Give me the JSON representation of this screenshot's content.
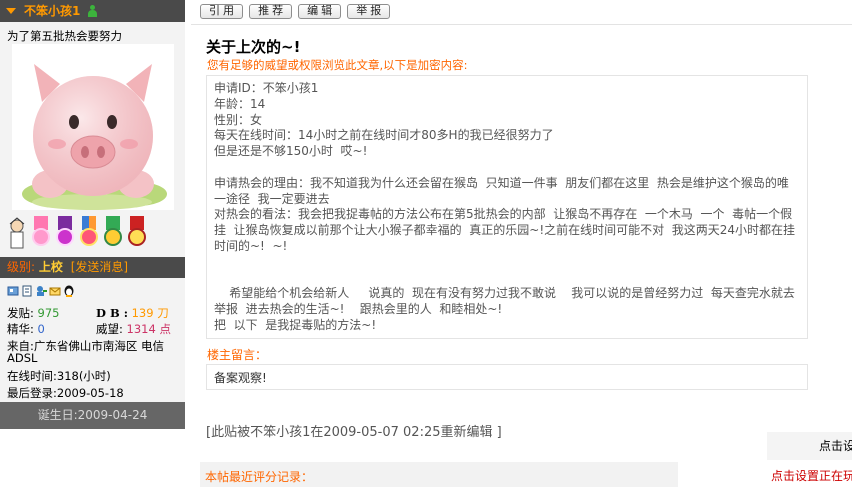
{
  "user": {
    "name": "不笨小孩1",
    "signature": "为了第五批热会要努力",
    "level_label": "级别:",
    "level": "上校",
    "pm": "[发送消息]",
    "stats": {
      "posts_label": "发贴:",
      "posts": "975",
      "db_label": "D B :",
      "db": "139 刀",
      "essence_label": "精华:",
      "essence": "0",
      "prestige_label": "威望:",
      "prestige": "1314 点"
    },
    "from": "来自:广东省佛山市南海区 电信ADSL",
    "online": "在线时间:318(小时)",
    "last_login": "最后登录:2009-05-18",
    "birthday": "诞生日:2009-04-24"
  },
  "toolbar": {
    "quote": "引 用",
    "recommend": "推 荐",
    "edit": "编 辑",
    "report": "举 报"
  },
  "post": {
    "title": "关于上次的~!",
    "notice": "您有足够的威望或权限浏览此文章,以下是加密内容:",
    "lines": [
      "申请ID：不笨小孩1",
      "年龄：14",
      "性别：女",
      "每天在线时间：14小时之前在线时间才80多H的我已经很努力了",
      "但是还是不够150小时  哎~!",
      "",
      "申请热会的理由：我不知道我为什么还会留在猴岛  只知道一件事  朋友们都在这里  热会是维护这个猴岛的唯一途径  我一定要进去",
      "对热会的看法：我会把我捉毒帖的方法公布在第5批热会的内部  让猴岛不再存在  一个木马  一个  毒帖一个假挂  让猴岛恢复成以前那个让大小猴子都幸福的  真正的乐园~!之前在线时间可能不对  我这两天24小时都在挂时间的~!  ~!",
      "",
      "",
      "    希望能给个机会给新人     说真的  现在有没有努力过我不敢说    我可以说的是曾经努力过  每天查完水就去  举报  进去热会的生活~!    跟热会里的人  和睦相处~!",
      "把  以下  是我捉毒贴的方法~!"
    ],
    "owner_label": "楼主留言：",
    "owner_msg": "备案观察!",
    "edited": "[此贴被不笨小孩1在2009-05-07 02:25重新编辑  ]",
    "rating_label": "本帖最近评分记录："
  },
  "float_panel": {
    "title": "点击设",
    "link": "点击设置正在玩"
  }
}
